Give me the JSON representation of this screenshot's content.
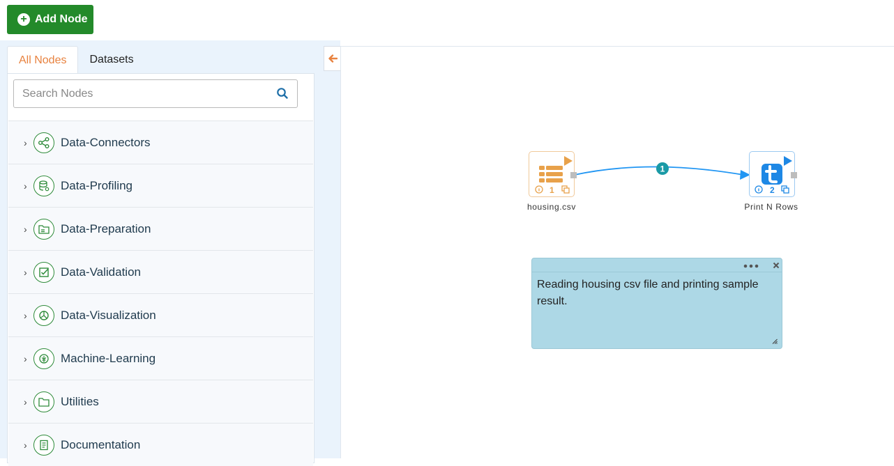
{
  "toolbar": {
    "add_node_label": "Add Node"
  },
  "tabs": [
    {
      "label": "All Nodes",
      "active": true
    },
    {
      "label": "Datasets",
      "active": false
    }
  ],
  "search": {
    "placeholder": "Search Nodes",
    "value": ""
  },
  "categories": [
    {
      "label": "Data-Connectors",
      "icon": "share-icon"
    },
    {
      "label": "Data-Profiling",
      "icon": "database-icon"
    },
    {
      "label": "Data-Preparation",
      "icon": "folder-table-icon"
    },
    {
      "label": "Data-Validation",
      "icon": "check-square-icon"
    },
    {
      "label": "Data-Visualization",
      "icon": "pie-chart-icon"
    },
    {
      "label": "Machine-Learning",
      "icon": "brain-icon"
    },
    {
      "label": "Utilities",
      "icon": "folder-icon"
    },
    {
      "label": "Documentation",
      "icon": "document-icon"
    }
  ],
  "workflow": {
    "nodes": [
      {
        "name": "housing.csv",
        "number": "1",
        "color": "#e8a14a",
        "icon": "csv-read-icon"
      },
      {
        "name": "Print N Rows",
        "number": "2",
        "color": "#1e88e5",
        "icon": "print-t-icon"
      }
    ],
    "edge": {
      "label": "1",
      "color": "#2196f3",
      "badge_color": "#1a9aa6"
    },
    "note": {
      "text": "Reading housing csv file and printing sample result."
    }
  },
  "colors": {
    "accent_green": "#238a2a",
    "active_tab": "#e8823f"
  }
}
